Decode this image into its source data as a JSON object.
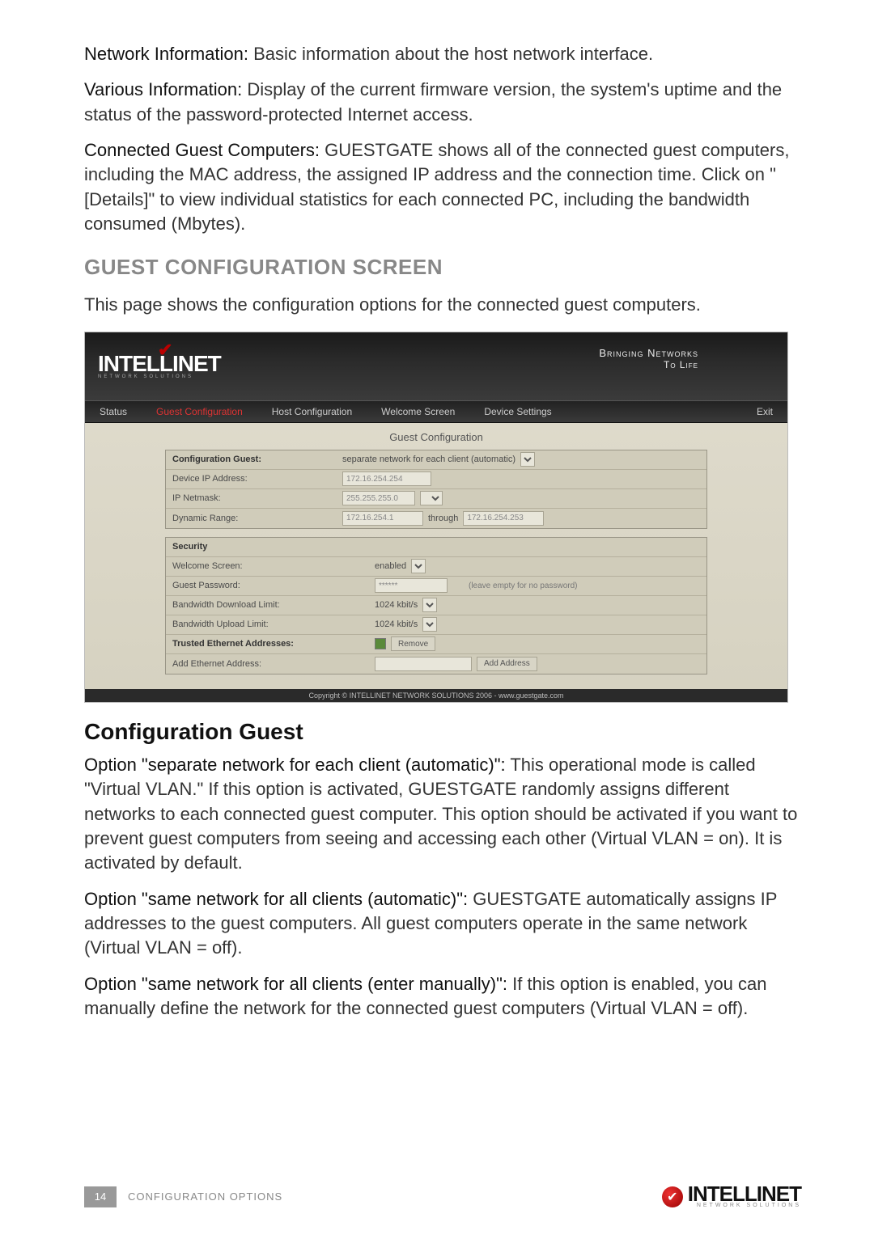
{
  "paragraphs": {
    "p1_lead": "Network Information:",
    "p1_body": " Basic information about the host network interface.",
    "p2_lead": "Various Information:",
    "p2_body": " Display of the current firmware version, the system's uptime and the status of the password-protected Internet access.",
    "p3_lead": "Connected Guest Computers:",
    "p3_body": " GUESTGATE shows all of the connected guest computers, including the MAC address, the assigned IP address and the connection time. Click on \"[Details]\" to view individual statistics for each connected PC, including the bandwidth consumed (Mbytes).",
    "h2": "GUEST CONFIGURATION SCREEN",
    "p4": "This page shows the configuration options for the connected guest computers.",
    "h3": "Configuration Guest",
    "p5_lead": "Option \"separate network for each client (automatic)\":",
    "p5_body": " This operational mode is called \"Virtual VLAN.\" If this option is activated, GUESTGATE randomly assigns different networks to each connected guest computer. This option should be activated if you want to prevent guest computers from seeing and accessing each other (Virtual VLAN = on). It is activated by default.",
    "p6_lead": "Option \"same network for all clients (automatic)\":",
    "p6_body": " GUESTGATE automatically assigns IP addresses to the guest computers. All guest computers operate in the same network (Virtual VLAN = off).",
    "p7_lead": "Option \"same network for all clients (enter manually)\":",
    "p7_body": " If this option is enabled, you can manually define the network for the connected guest computers (Virtual VLAN = off)."
  },
  "ui": {
    "logo": "INTELLINET",
    "logo_sub": "NETWORK SOLUTIONS",
    "tagline1": "Bringing Networks",
    "tagline2": "To Life",
    "nav": {
      "status": "Status",
      "guest": "Guest Configuration",
      "host": "Host Configuration",
      "welcome": "Welcome Screen",
      "device": "Device Settings",
      "exit": "Exit"
    },
    "title": "Guest Configuration",
    "rows": {
      "config_guest_label": "Configuration Guest:",
      "config_guest_value": "separate network for each client (automatic)",
      "device_ip_label": "Device IP Address:",
      "device_ip_value": "172.16.254.254",
      "netmask_label": "IP Netmask:",
      "netmask_value": "255.255.255.0",
      "dynrange_label": "Dynamic Range:",
      "dynrange_from": "172.16.254.1",
      "dynrange_through_label": "through",
      "dynrange_to": "172.16.254.253",
      "security_header": "Security",
      "welcome_label": "Welcome Screen:",
      "welcome_value": "enabled",
      "guestpw_label": "Guest Password:",
      "guestpw_value": "******",
      "guestpw_note": "(leave empty for no password)",
      "bwdown_label": "Bandwidth Download Limit:",
      "bwdown_value": "1024 kbit/s",
      "bwup_label": "Bandwidth Upload Limit:",
      "bwup_value": "1024 kbit/s",
      "trusted_label": "Trusted Ethernet Addresses:",
      "remove_btn": "Remove",
      "addeth_label": "Add Ethernet Address:",
      "addaddr_btn": "Add Address"
    },
    "footer": "Copyright © INTELLINET NETWORK SOLUTIONS 2006 - www.guestgate.com"
  },
  "page_footer": {
    "page_num": "14",
    "section": "CONFIGURATION OPTIONS",
    "brand": "INTELLINET",
    "brand_sub": "NETWORK SOLUTIONS"
  }
}
